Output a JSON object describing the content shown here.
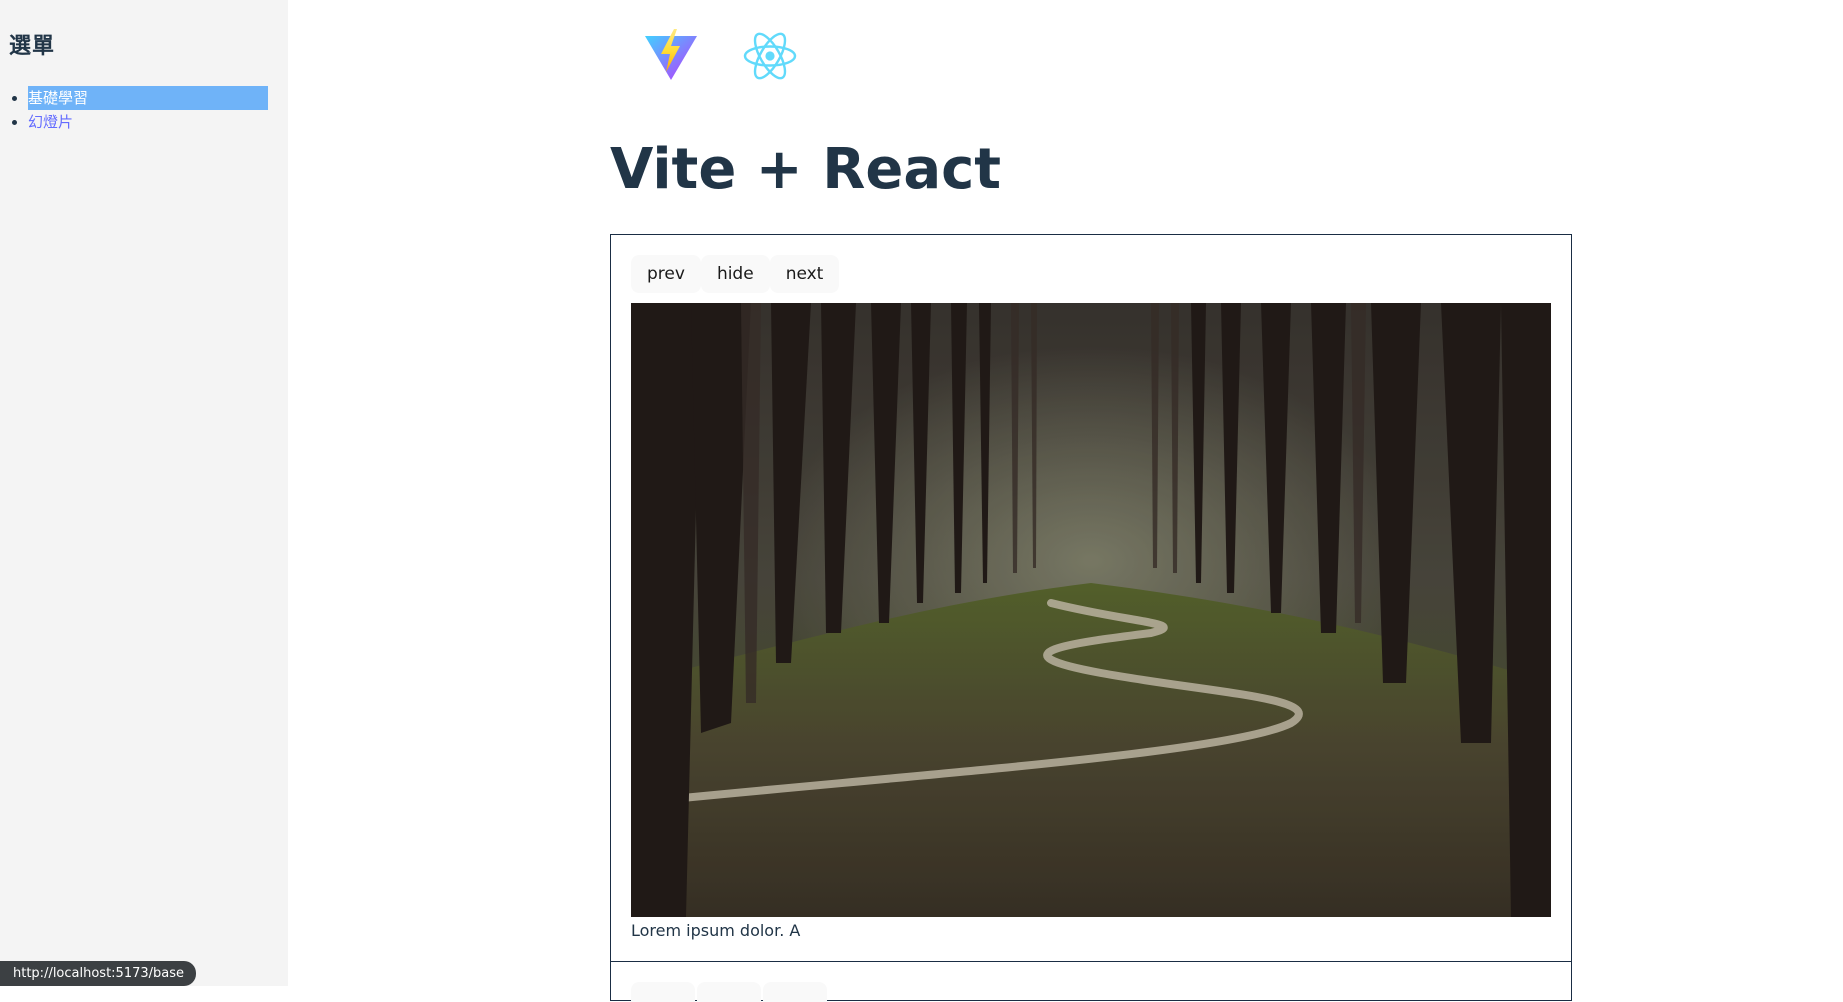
{
  "sidebar": {
    "title": "選單",
    "items": [
      {
        "label": "基礎學習",
        "active": true
      },
      {
        "label": "幻燈片",
        "active": false
      }
    ]
  },
  "status_bar": {
    "url": "http://localhost:5173/base"
  },
  "header": {
    "logos": [
      "vite-logo",
      "react-logo"
    ],
    "title": "Vite + React"
  },
  "carousel": {
    "buttons": {
      "prev": "prev",
      "hide": "hide",
      "next": "next"
    },
    "image_subject": "forest path",
    "caption": "Lorem ipsum dolor. A"
  },
  "colors": {
    "link": "#646cff",
    "active_highlight": "#6fb3f8",
    "text": "#213547",
    "sidebar_bg": "#f4f4f4",
    "border": "#1a2d44"
  }
}
